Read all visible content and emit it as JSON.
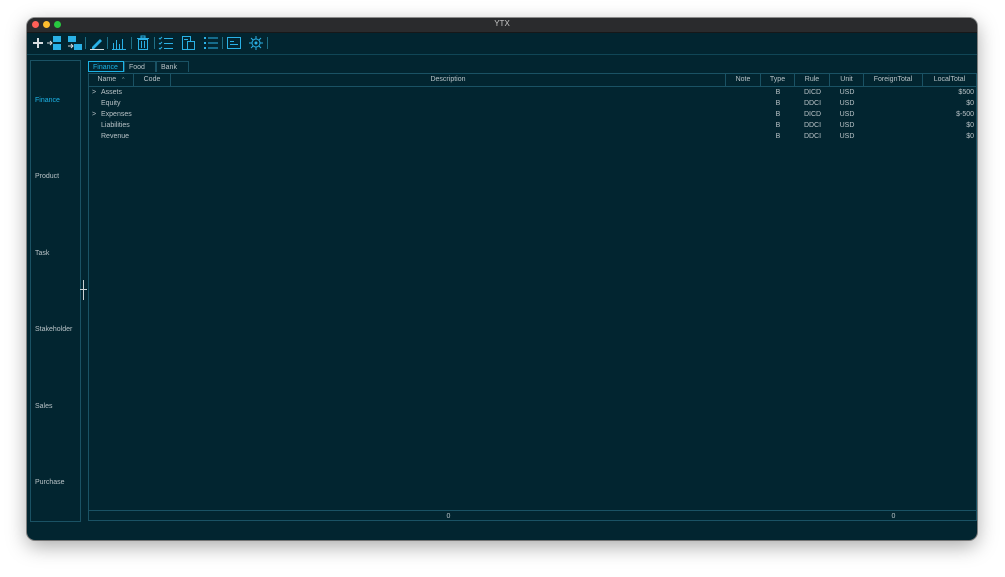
{
  "window": {
    "title": "YTX"
  },
  "toolbar": {
    "icons": [
      "plus-icon",
      "insert-left-icon",
      "insert-right-icon",
      "edit-icon",
      "chart-icon",
      "trash-icon",
      "checklist-icon",
      "document-icon",
      "list-icon",
      "terminal-icon",
      "settings-icon"
    ]
  },
  "sidebar": {
    "items": [
      {
        "label": "Finance",
        "active": true
      },
      {
        "label": "Product"
      },
      {
        "label": "Task"
      },
      {
        "label": "Stakeholder"
      },
      {
        "label": "Sales"
      },
      {
        "label": "Purchase"
      }
    ]
  },
  "tabs": [
    {
      "label": "Finance",
      "active": true
    },
    {
      "label": "Food"
    },
    {
      "label": "Bank"
    }
  ],
  "table": {
    "columns": [
      "Name",
      "Code",
      "Description",
      "Note",
      "Type",
      "Rule",
      "Unit",
      "ForeignTotal",
      "LocalTotal"
    ],
    "sort_indicator": "^",
    "rows": [
      {
        "expandable": true,
        "expander": ">",
        "name": "Assets",
        "type": "B",
        "rule": "DICD",
        "unit": "USD",
        "local_total": "$500"
      },
      {
        "expandable": false,
        "expander": "",
        "name": "Equity",
        "type": "B",
        "rule": "DDCI",
        "unit": "USD",
        "local_total": "$0"
      },
      {
        "expandable": true,
        "expander": ">",
        "name": "Expenses",
        "type": "B",
        "rule": "DICD",
        "unit": "USD",
        "local_total": "$-500"
      },
      {
        "expandable": false,
        "expander": "",
        "name": "Liabilities",
        "type": "B",
        "rule": "DDCI",
        "unit": "USD",
        "local_total": "$0"
      },
      {
        "expandable": false,
        "expander": "",
        "name": "Revenue",
        "type": "B",
        "rule": "DDCI",
        "unit": "USD",
        "local_total": "$0"
      }
    ],
    "footer": {
      "description_total": "0",
      "foreign_total": "0"
    }
  },
  "colors": {
    "background": "#022530",
    "accent": "#1cb3e6",
    "text": "#b9c3c7",
    "border": "#1a5264"
  }
}
